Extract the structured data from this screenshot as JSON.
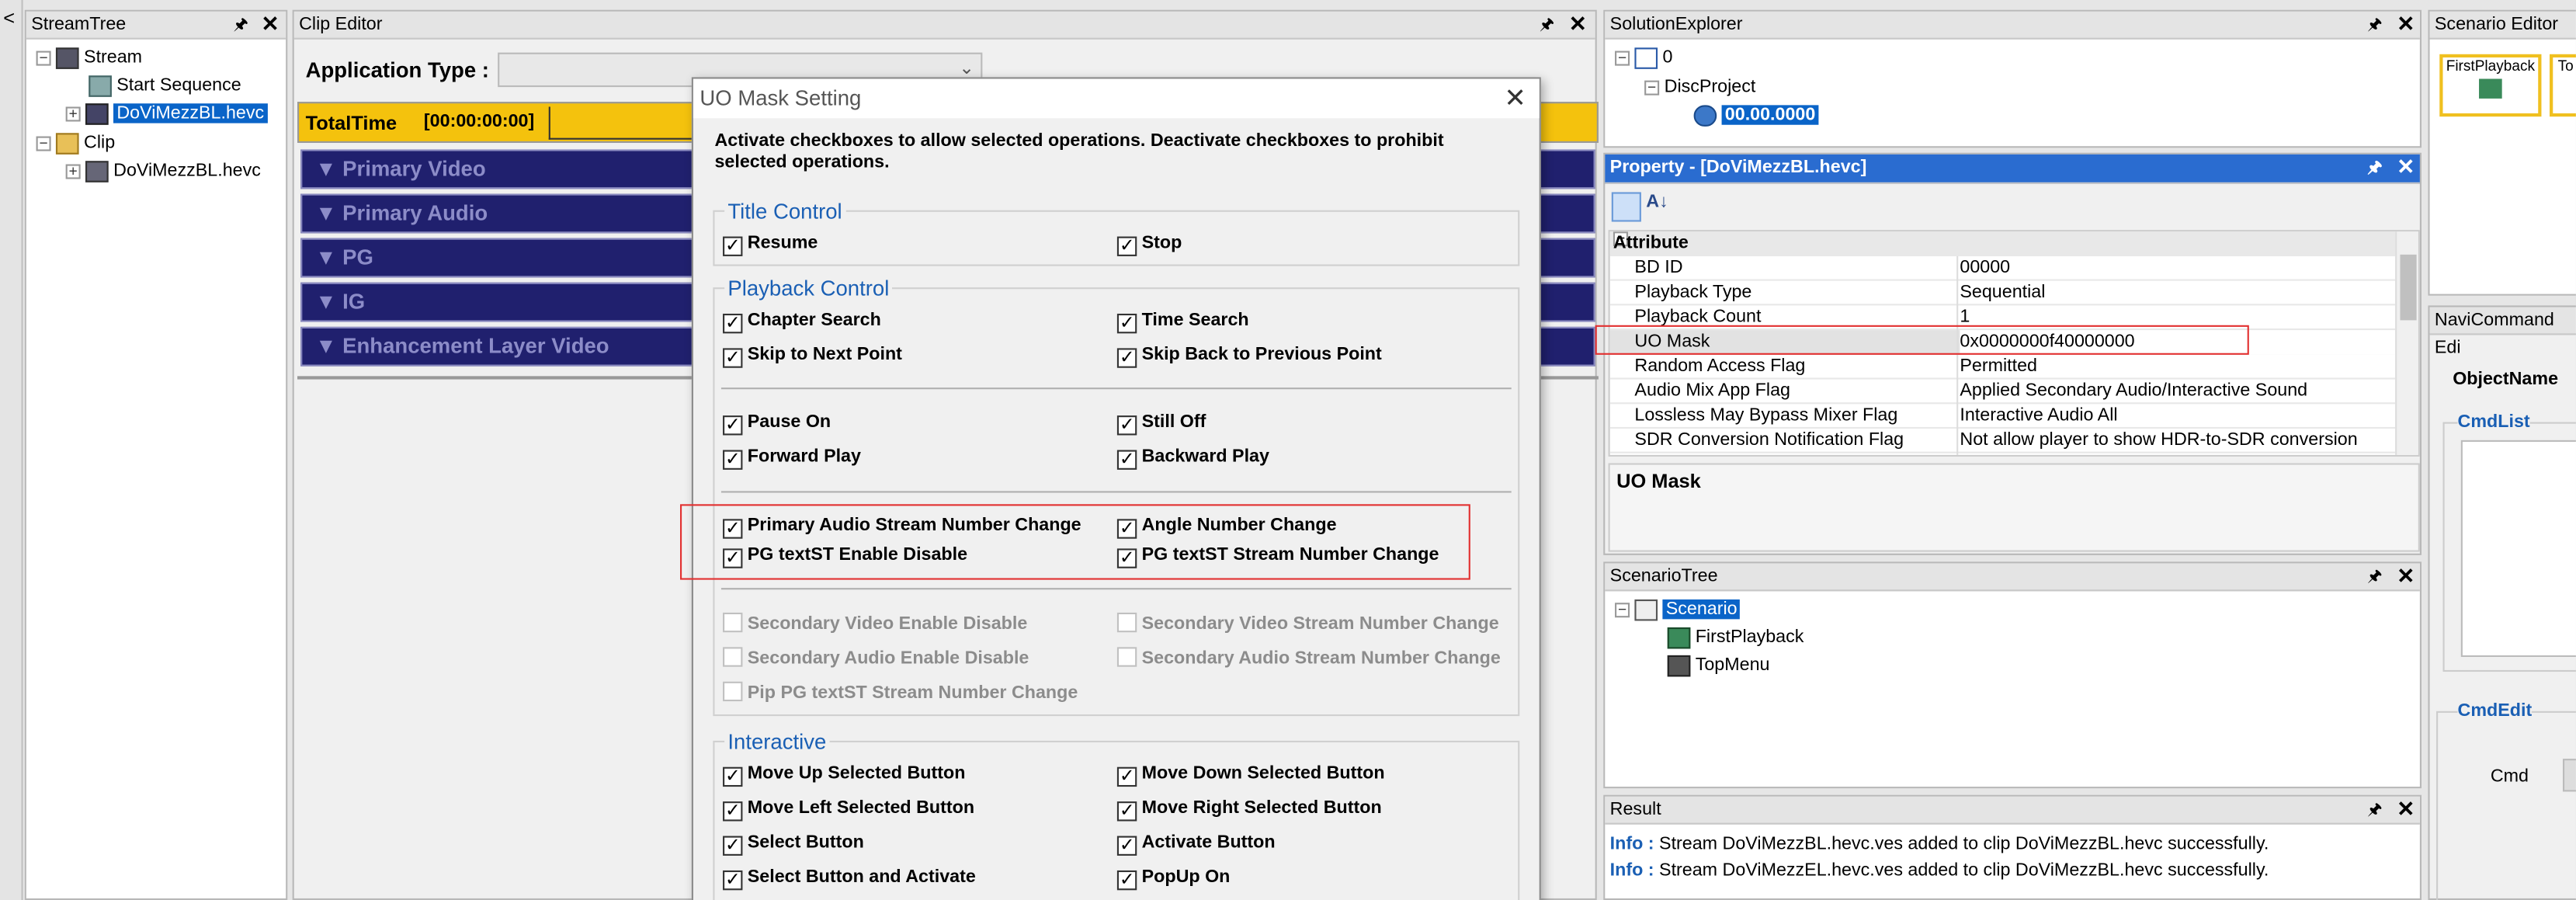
{
  "streamtree": {
    "title": "StreamTree",
    "stream": "Stream",
    "start_sequence": "Start Sequence",
    "stream_file": "DoViMezzBL.hevc",
    "clip": "Clip",
    "clip_file": "DoViMezzBL.hevc"
  },
  "clip_editor": {
    "title": "Clip Editor",
    "app_type_label": "Application Type :",
    "total_time_label": "TotalTime",
    "total_time_value": "[00:00:00:00]",
    "tracks": [
      "▼ Primary Video",
      "▼ Primary Audio",
      "▼ PG",
      "▼ IG",
      "▼ Enhancement Layer Video"
    ]
  },
  "dialog": {
    "title": "UO Mask Setting",
    "description": "Activate checkboxes to allow selected operations.  Deactivate checkboxes to prohibit selected operations.",
    "title_control": {
      "label": "Title Control",
      "resume": "Resume",
      "stop": "Stop"
    },
    "playback_control": {
      "label": "Playback Control",
      "chapter_search": "Chapter Search",
      "time_search": "Time Search",
      "skip_next": "Skip to Next Point",
      "skip_back": "Skip Back to Previous Point",
      "pause_on": "Pause On",
      "still_off": "Still Off",
      "forward_play": "Forward Play",
      "backward_play": "Backward Play",
      "primary_audio_change": "Primary Audio Stream Number Change",
      "angle_change": "Angle Number Change",
      "pg_textst_enable": "PG textST Enable Disable",
      "pg_textst_change": "PG textST Stream Number Change",
      "secondary_video_enable": "Secondary Video Enable Disable",
      "secondary_video_change": "Secondary Video Stream Number Change",
      "secondary_audio_enable": "Secondary Audio Enable Disable",
      "secondary_audio_change": "Secondary Audio Stream Number Change",
      "pip_pg_change": "Pip PG textST Stream Number Change"
    },
    "interactive": {
      "label": "Interactive",
      "move_up": "Move Up Selected Button",
      "move_down": "Move Down Selected Button",
      "move_left": "Move Left Selected Button",
      "move_right": "Move Right Selected Button",
      "select_button": "Select Button",
      "activate_button": "Activate Button",
      "select_activate": "Select Button and Activate",
      "popup_on": "PopUp On"
    }
  },
  "solution": {
    "title": "SolutionExplorer",
    "root": "0",
    "project": "DiscProject",
    "item": "00.00.0000"
  },
  "property": {
    "title": "Property - [DoViMezzBL.hevc]",
    "category": "Attribute",
    "rows": [
      {
        "k": "BD ID",
        "v": "00000"
      },
      {
        "k": "Playback Type",
        "v": "Sequential"
      },
      {
        "k": "Playback Count",
        "v": "1"
      },
      {
        "k": "UO Mask",
        "v": "0x0000000f40000000"
      },
      {
        "k": "Random Access Flag",
        "v": "Permitted"
      },
      {
        "k": "Audio Mix App Flag",
        "v": "Applied Secondary Audio/Interactive Sound"
      },
      {
        "k": "Lossless May Bypass Mixer Flag",
        "v": "Interactive Audio All"
      },
      {
        "k": "SDR Conversion Notification Flag",
        "v": "Not allow player to show HDR-to-SDR conversion notificati"
      }
    ],
    "desc_title": "UO Mask"
  },
  "scenario_tree": {
    "title": "ScenarioTree",
    "root": "Scenario",
    "first": "FirstPlayback",
    "top": "TopMenu"
  },
  "result": {
    "title": "Result",
    "lines": [
      {
        "tag": "Info :",
        "msg": " Stream DoViMezzBL.hevc.ves added to clip DoViMezzBL.hevc successfully."
      },
      {
        "tag": "Info :",
        "msg": " Stream DoViMezzEL.hevc.ves added to clip DoViMezzBL.hevc successfully."
      }
    ]
  },
  "scenario_editor": {
    "title": "Scenario Editor",
    "card1": "FirstPlayback",
    "card2": "To"
  },
  "navicommand": {
    "title": "NaviCommand Edi",
    "object_name": "ObjectName",
    "cmdlist": "CmdList",
    "cmdedit": "CmdEdit",
    "cmd": "Cmd"
  }
}
